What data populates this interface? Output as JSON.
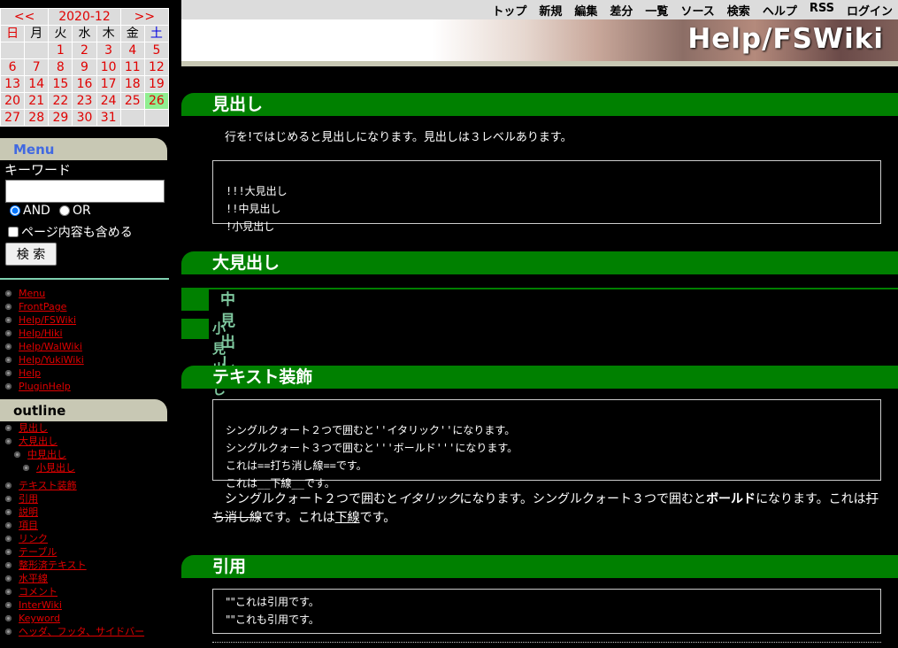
{
  "calendar": {
    "prev": "<<",
    "month": "2020-12",
    "next": ">>",
    "weekdays": [
      "日",
      "月",
      "火",
      "水",
      "木",
      "金",
      "土"
    ],
    "weeks": [
      [
        "",
        "",
        "1",
        "2",
        "3",
        "4",
        "5"
      ],
      [
        "6",
        "7",
        "8",
        "9",
        "10",
        "11",
        "12"
      ],
      [
        "13",
        "14",
        "15",
        "16",
        "17",
        "18",
        "19"
      ],
      [
        "20",
        "21",
        "22",
        "23",
        "24",
        "25",
        "26"
      ],
      [
        "27",
        "28",
        "29",
        "30",
        "31",
        "",
        ""
      ]
    ],
    "today": "26"
  },
  "menu": {
    "title": "Menu",
    "keyword_label": "キーワード",
    "keyword_value": "",
    "and_label": "AND",
    "or_label": "OR",
    "include_page_label": "ページ内容も含める",
    "search_button": "検 索",
    "links": [
      "Menu",
      "FrontPage",
      "Help/FSWiki",
      "Help/Hiki",
      "Help/WalWiki",
      "Help/YukiWiki",
      "Help",
      "PluginHelp"
    ]
  },
  "outline": {
    "title": "outline",
    "items": [
      {
        "label": "見出し",
        "level": 1
      },
      {
        "label": "大見出し",
        "level": 1
      },
      {
        "label": "中見出し",
        "level": 2
      },
      {
        "label": "小見出し",
        "level": 3
      },
      {
        "label": "テキスト装飾",
        "level": 1,
        "gap": true
      },
      {
        "label": "引用",
        "level": 1
      },
      {
        "label": "説明",
        "level": 1
      },
      {
        "label": "項目",
        "level": 1
      },
      {
        "label": "リンク",
        "level": 1
      },
      {
        "label": "テーブル",
        "level": 1
      },
      {
        "label": "整形済テキスト",
        "level": 1
      },
      {
        "label": "水平線",
        "level": 1
      },
      {
        "label": "コメント",
        "level": 1
      },
      {
        "label": "InterWiki",
        "level": 1
      },
      {
        "label": "Keyword",
        "level": 1
      },
      {
        "label": "ヘッダ、フッタ、サイドバー",
        "level": 1
      }
    ]
  },
  "topnav": [
    "トップ",
    "新規",
    "編集",
    "差分",
    "一覧",
    "ソース",
    "検索",
    "ヘルプ",
    "RSS",
    "ログイン"
  ],
  "page_title": "Help/FSWiki",
  "content": {
    "sec_heading": "見出し",
    "sec_heading_text": "行を!ではじめると見出しになります。見出しは３レベルあります。",
    "sec_heading_code": [
      "!!!大見出し",
      "!!中見出し",
      "!小見出し"
    ],
    "h_large": "大見出し",
    "h_medium": "中見出し",
    "h_small": "小見出し",
    "sec_text": "テキスト装飾",
    "sec_text_code": [
      "シングルクォート２つで囲むと''イタリック''になります。",
      "シングルクォート３つで囲むと'''ボールド'''になります。",
      "これは==打ち消し線==です。",
      "これは__下線__です。"
    ],
    "fmt_1": "シングルクォート２つで囲むと",
    "fmt_italic": "イタリック",
    "fmt_2": "になります。シングルクォート３つで囲むと",
    "fmt_bold": "ボールド",
    "fmt_3": "になります。これは",
    "fmt_strike": "打ち消し線",
    "fmt_4": "です。これは",
    "fmt_under": "下線",
    "fmt_5": "です。",
    "sec_quote": "引用",
    "sec_quote_code": [
      "\"\"これは引用です。",
      "\"\"これも引用です。"
    ]
  }
}
